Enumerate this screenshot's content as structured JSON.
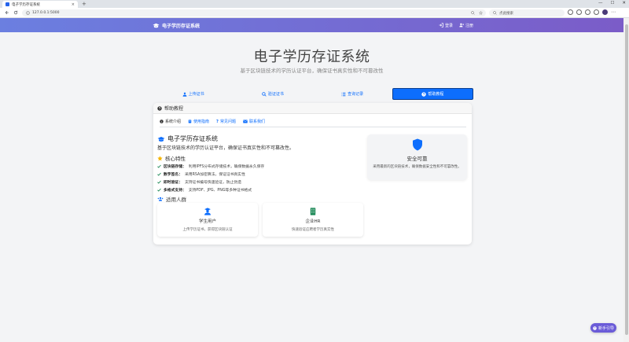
{
  "browser": {
    "tab_title": "电子学历存证系统",
    "tab_close": "×",
    "new_tab": "+",
    "window_controls": [
      "—",
      "☐",
      "✕"
    ],
    "url": "127.0.0.1:5000",
    "search_placeholder": "点此搜索",
    "menu": "⋯"
  },
  "navbar": {
    "brand": "电子学历存证系统",
    "login": "登录",
    "register": "注册"
  },
  "hero": {
    "title": "电子学历存证系统",
    "subtitle": "基于区块链技术的学历认证平台，确保证书真实性和不可篡改性"
  },
  "main_tabs": [
    {
      "label": "上传证书",
      "icon": "user-upload-icon"
    },
    {
      "label": "验证证书",
      "icon": "search-icon"
    },
    {
      "label": "查询记录",
      "icon": "list-icon"
    },
    {
      "label": "帮助教程",
      "icon": "question-icon",
      "active": true
    }
  ],
  "card": {
    "header": "帮助教程",
    "subtabs": [
      {
        "label": "系统介绍",
        "active": true
      },
      {
        "label": "使用指南"
      },
      {
        "label": "常见问题"
      },
      {
        "label": "联系我们"
      }
    ],
    "system_title": "电子学历存证系统",
    "system_desc": "基于区块链技术的学历认证平台，确保证书真实性和不可篡改性。",
    "features_title": "核心特性",
    "features": [
      {
        "name": "区块链存储：",
        "desc": "利用IPFS分布式存储技术，确保数据永久保存"
      },
      {
        "name": "数字签名：",
        "desc": "采用RSA加密算法，保证证书真实性"
      },
      {
        "name": "即时验证：",
        "desc": "支持证书编号快速验证，防止伪造"
      },
      {
        "name": "多格式支持：",
        "desc": "支持PDF、JPG、PNG等多种证书格式"
      }
    ],
    "audience_title": "适用人群",
    "audiences": [
      {
        "name": "学生用户",
        "desc": "上传学历证书，获得区块链认证"
      },
      {
        "name": "企业HR",
        "desc": "快速验证应聘者学历真实性"
      }
    ],
    "safe_title": "安全可靠",
    "safe_desc": "采用最新的区块链技术，确保数据安全性和不可篡改性。"
  },
  "guide_button": "新手引导",
  "colors": {
    "primary": "#0d6efd",
    "navbar_start": "#6b7fe0",
    "navbar_end": "#7b5cc8",
    "shield": "#0d6efd"
  }
}
